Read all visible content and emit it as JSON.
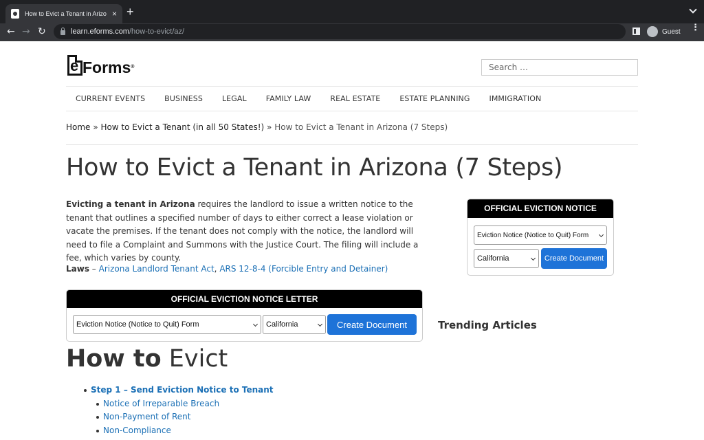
{
  "browser": {
    "tab_title": "How to Evict a Tenant in Arizo",
    "tab_close": "×",
    "new_tab": "+",
    "url_host": "learn.eforms.com",
    "url_path": "/how-to-evict/az/",
    "profile_label": "Guest",
    "back": "←",
    "forward": "→",
    "reload": "↻",
    "menu": "⋮"
  },
  "header": {
    "logo_e": "e",
    "logo_text": "Forms",
    "logo_reg": "®",
    "search_placeholder": "Search …"
  },
  "nav": [
    "CURRENT EVENTS",
    "BUSINESS",
    "LEGAL",
    "FAMILY LAW",
    "REAL ESTATE",
    "ESTATE PLANNING",
    "IMMIGRATION"
  ],
  "breadcrumb": {
    "home": "Home",
    "sep": "»",
    "parent": "How to Evict a Tenant (in all 50 States!)",
    "current": "How to Evict a Tenant in Arizona (7 Steps)"
  },
  "page_title": "How to Evict a Tenant in Arizona (7 Steps)",
  "intro": {
    "bold": "Evicting a tenant in Arizona",
    "text": " requires the landlord to issue a written notice to the tenant that outlines a specified number of days to either correct a lease violation or vacate the premises. If the tenant does not comply with the notice, the landlord will need to file a Complaint and Summons with the Justice Court. The filing will include a fee, which varies by county."
  },
  "laws": {
    "label": "Laws",
    "dash": " – ",
    "link1": "Arizona Landlord Tenant Act",
    "comma": ", ",
    "link2": "ARS 12-8-4 (Forcible Entry and Detainer)"
  },
  "widget_main": {
    "title": "OFFICIAL EVICTION NOTICE LETTER",
    "form_select": "Eviction Notice (Notice to Quit) Form",
    "state_select": "California",
    "button": "Create Document"
  },
  "widget_side": {
    "title": "OFFICIAL EVICTION NOTICE",
    "form_select": "Eviction Notice (Notice to Quit) Form",
    "state_select": "California",
    "button": "Create Document"
  },
  "trending": "Trending Articles",
  "howto": {
    "bold": "How to",
    "rest": " Evict"
  },
  "steps": {
    "step1": "Step 1 – Send Eviction Notice to Tenant",
    "sub": [
      "Notice of Irreparable Breach",
      "Non-Payment of Rent",
      "Non-Compliance"
    ]
  }
}
